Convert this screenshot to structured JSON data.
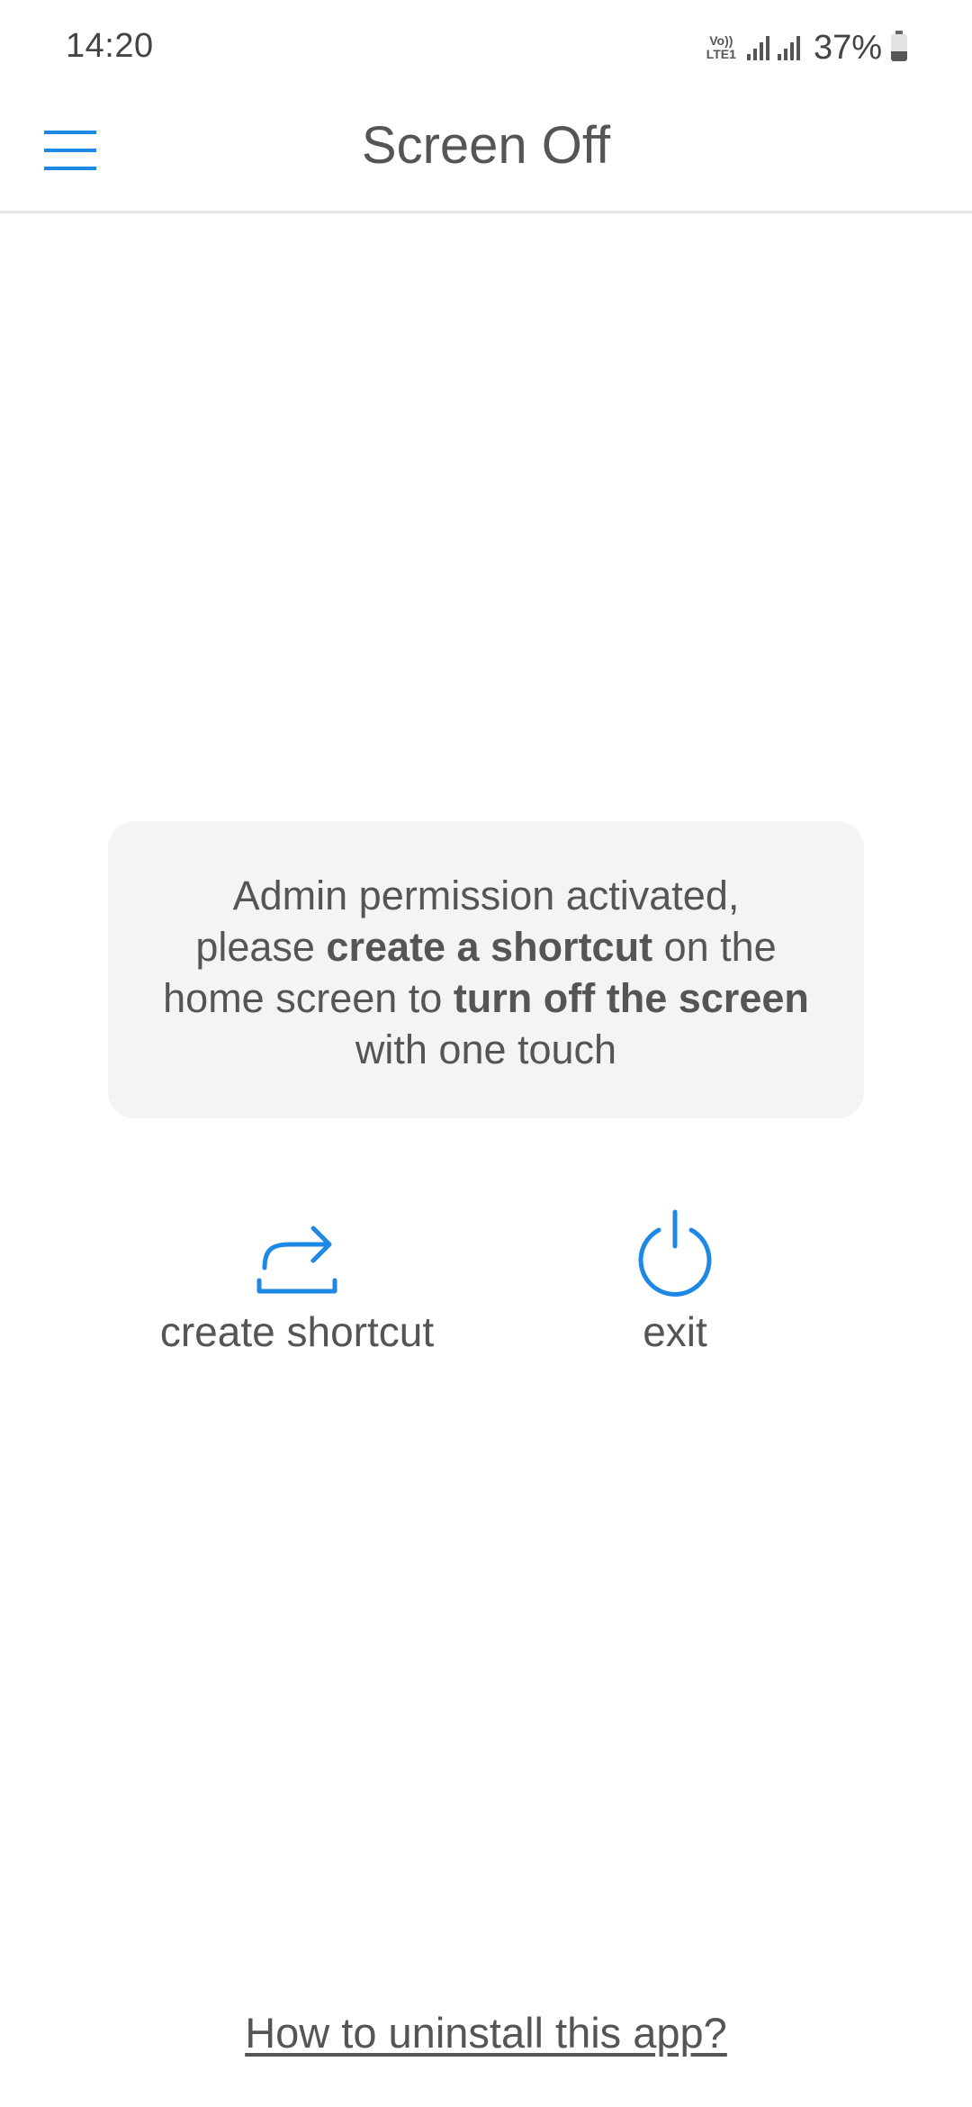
{
  "status_bar": {
    "time": "14:20",
    "volte_top": "Vo))",
    "volte_bottom": "LTE1",
    "battery_percent": "37%",
    "battery_level": 0.37,
    "icons": [
      "volte-lte-icon",
      "signal-icon",
      "signal-icon",
      "battery-icon"
    ]
  },
  "app_bar": {
    "title": "Screen Off",
    "menu_icon": "hamburger-menu-icon"
  },
  "info_card": {
    "line1": "Admin permission activated,",
    "line2_prefix": "please ",
    "line2_bold": "create a shortcut",
    "line2_suffix": " on the",
    "line3_prefix": "home screen to ",
    "line3_bold": "turn off the screen",
    "line4": "with one touch"
  },
  "actions": {
    "create_shortcut_label": "create shortcut",
    "create_shortcut_icon": "share-arrow-icon",
    "exit_label": "exit",
    "exit_icon": "power-icon"
  },
  "footer": {
    "uninstall_link": "How to uninstall this app?"
  },
  "colors": {
    "accent": "#1e88e5",
    "text": "#555555",
    "card_background": "#f4f4f4",
    "divider": "#e6e6e6"
  }
}
